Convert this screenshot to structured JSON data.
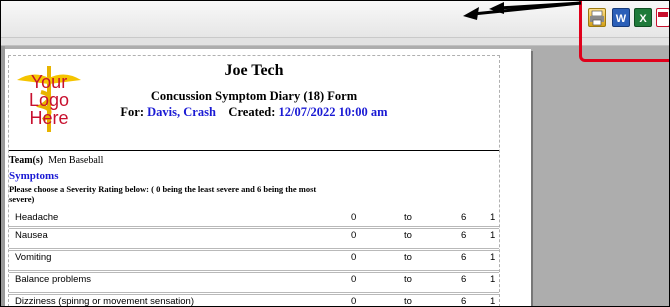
{
  "report": {
    "company_name": "Joe Tech",
    "form_title": "Concussion Symptom Diary (18) Form",
    "for_label": "For:",
    "patient_name": "Davis, Crash",
    "created_label": "Created:",
    "created_value": "12/07/2022 10:00 am",
    "logo": {
      "line1": "Your",
      "line2": "Logo",
      "line3": "Here"
    },
    "team_label": "Team(s)",
    "team_value": "Men Baseball",
    "symptoms_heading": "Symptoms",
    "instructions": "Please choose a Severity Rating below: ( 0 being the least severe and 6 being the most severe)",
    "symptoms": [
      {
        "name": "Headache",
        "min": "0",
        "to": "to",
        "max": "6",
        "value": "1"
      },
      {
        "name": "Nausea",
        "min": "0",
        "to": "to",
        "max": "6",
        "value": "1"
      },
      {
        "name": "Vomiting",
        "min": "0",
        "to": "to",
        "max": "6",
        "value": "1"
      },
      {
        "name": "Balance problems",
        "min": "0",
        "to": "to",
        "max": "6",
        "value": "1"
      },
      {
        "name": "Dizziness (spinng or movement sensation)",
        "min": "0",
        "to": "to",
        "max": "6",
        "value": "1"
      }
    ]
  },
  "toolbar": {
    "icons": [
      "print-icon",
      "word-icon",
      "excel-icon",
      "pdf-icon"
    ],
    "highlight_color": "#e0001b"
  },
  "colors": {
    "accent_blue": "#1a1ad4",
    "logo_gold": "#e8b400",
    "logo_red": "#c8102e"
  }
}
